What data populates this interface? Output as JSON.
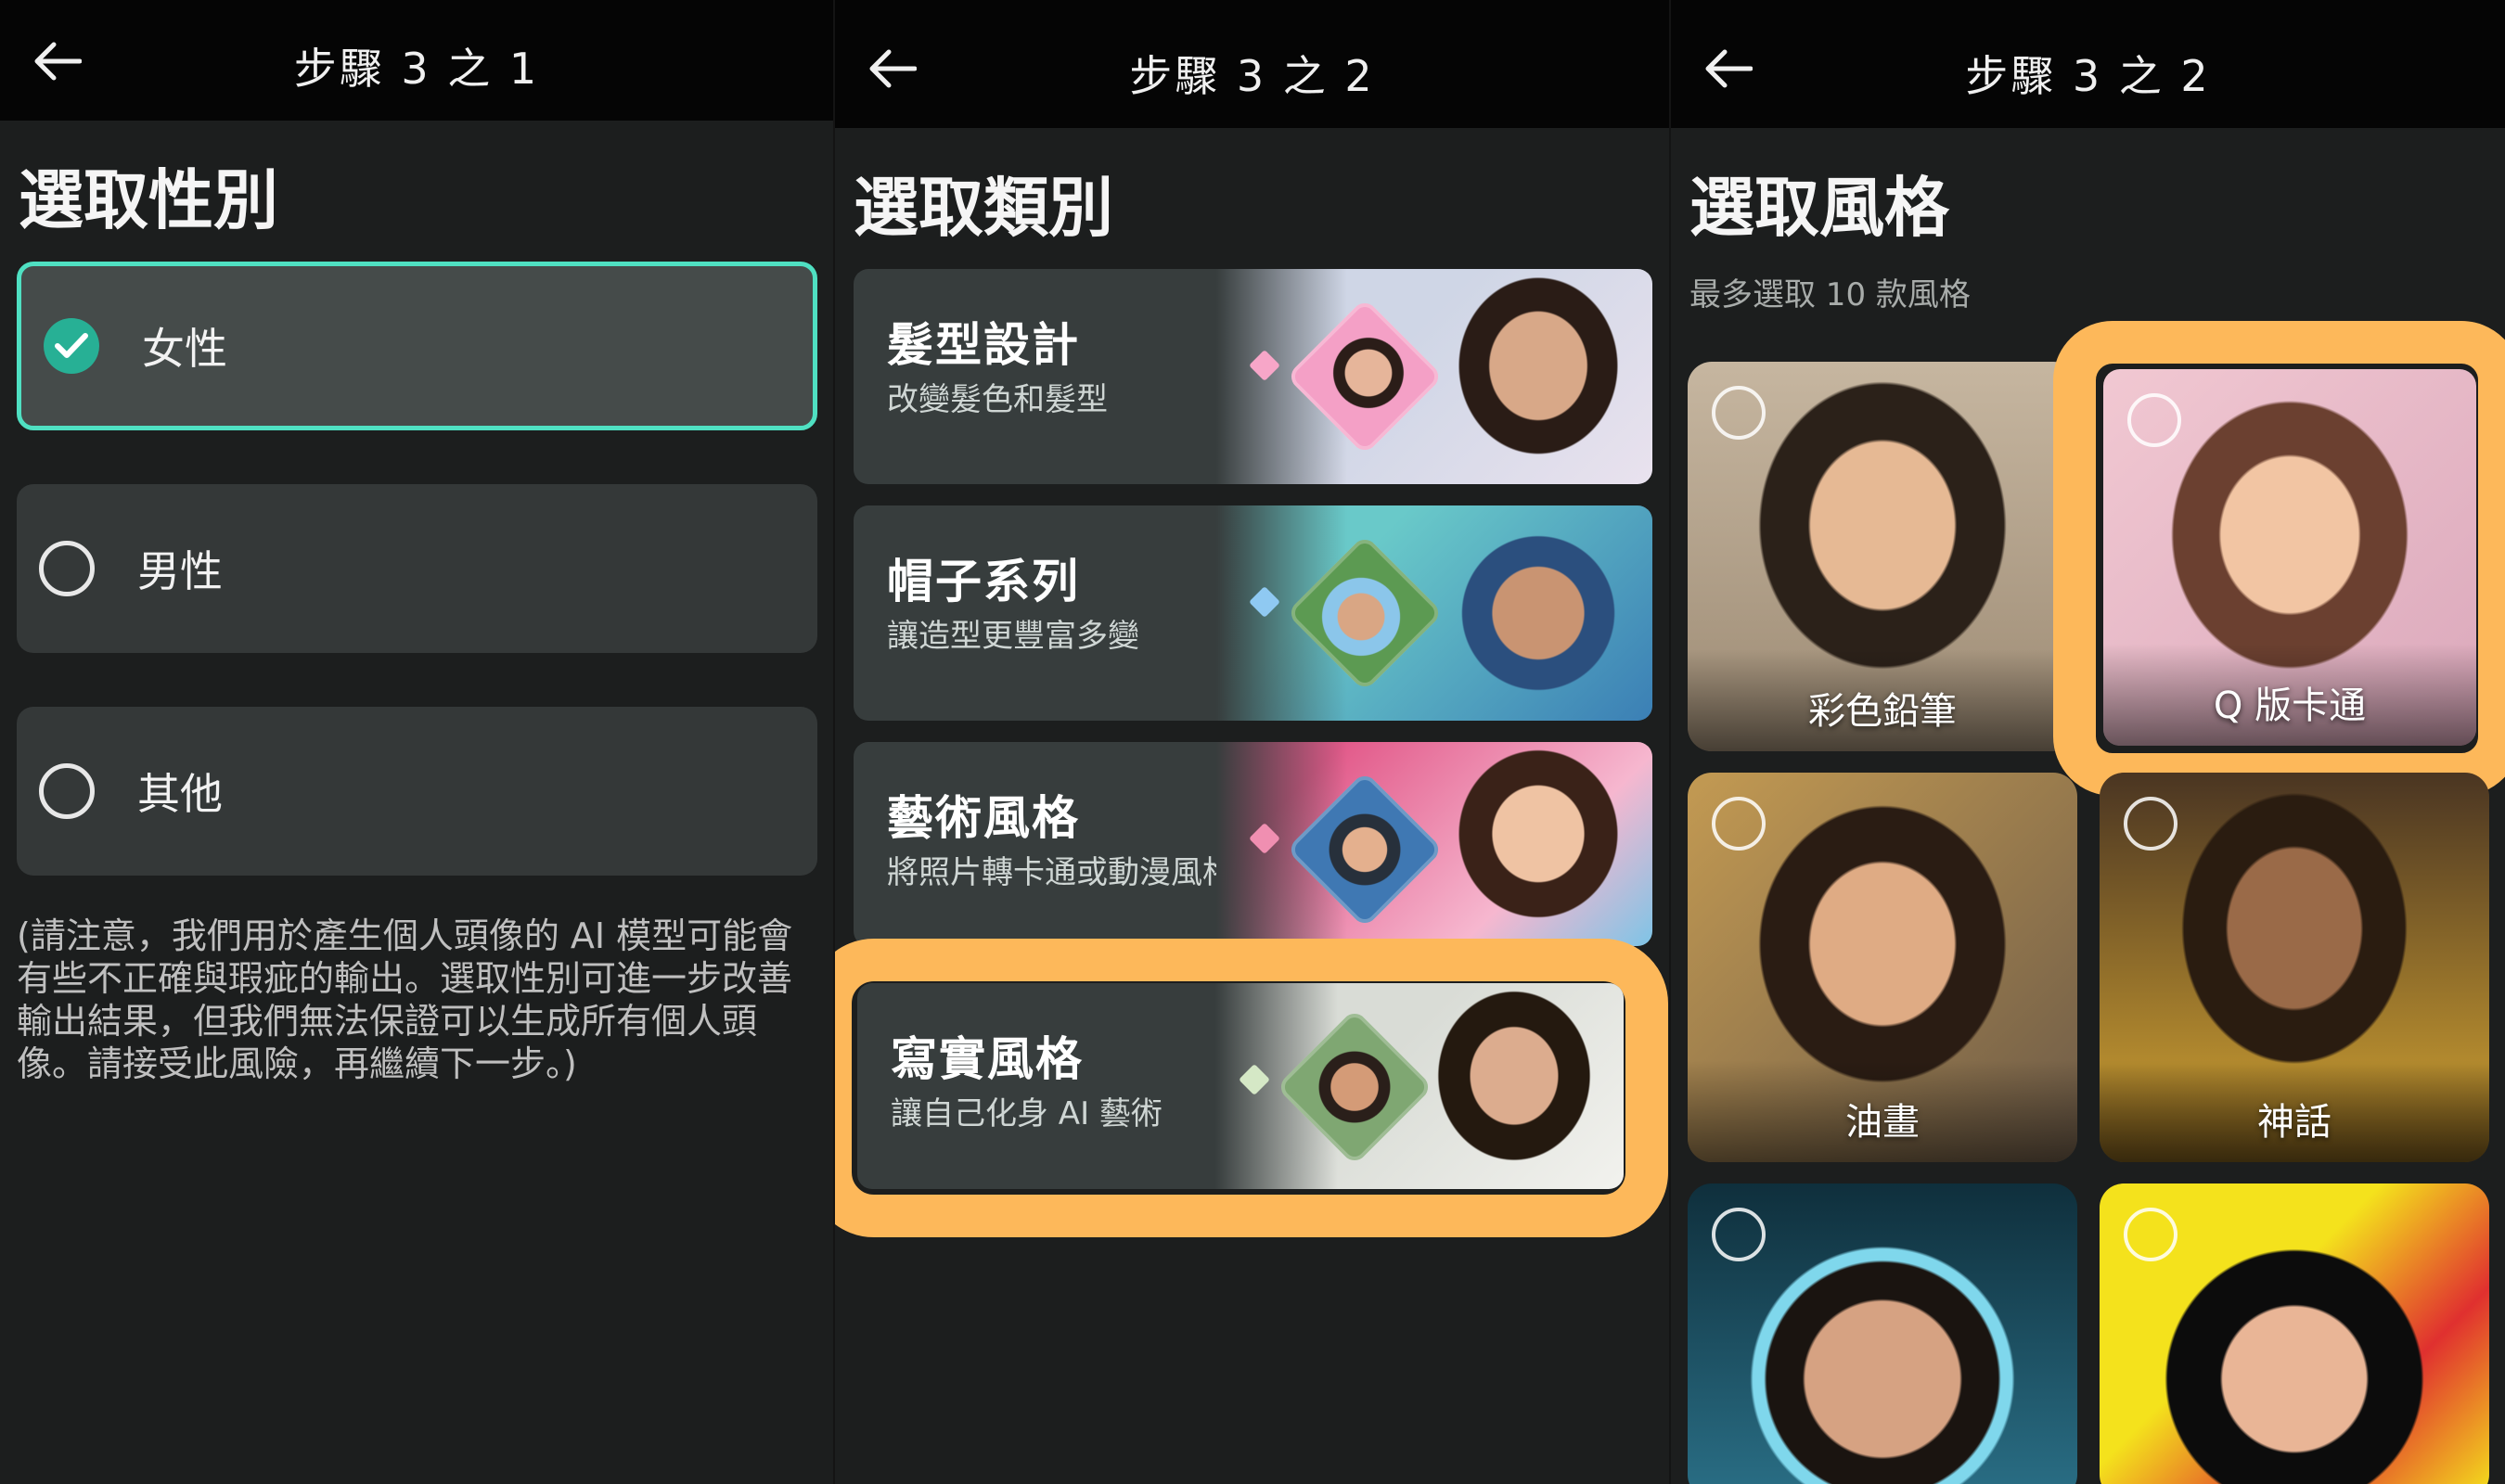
{
  "panel1": {
    "header": {
      "title": "步驟 3 之 1"
    },
    "title": "選取性別",
    "options": [
      {
        "label": "女性",
        "selected": true
      },
      {
        "label": "男性",
        "selected": false
      },
      {
        "label": "其他",
        "selected": false
      }
    ],
    "disclaimer": "(請注意，我們用於產生個人頭像的 AI 模型可能會有些不正確與瑕疵的輸出。選取性別可進一步改善輸出結果，但我們無法保證可以生成所有個人頭像。請接受此風險，再繼續下一步。)"
  },
  "panel2": {
    "header": {
      "title": "步驟 3 之 2"
    },
    "title": "選取類別",
    "categories": [
      {
        "name": "髮型設計",
        "desc": "改變髮色和髮型",
        "accent": "#f28ab8",
        "dot": "#f7a6c8"
      },
      {
        "name": "帽子系列",
        "desc": "讓造型更豐富多變",
        "accent": "#6fb3e6",
        "dot": "#8fc9f2"
      },
      {
        "name": "藝術風格",
        "desc": "將照片轉卡通或動漫風格",
        "accent": "#e86a9a",
        "dot": "#f08fb1"
      },
      {
        "name": "寫實風格",
        "desc": "讓自己化身 AI 藝術",
        "accent": "#8cb88a",
        "dot": "#d5e8c6",
        "highlighted": true
      }
    ]
  },
  "panel3": {
    "header": {
      "title": "步驟 3 之 2"
    },
    "title": "選取風格",
    "subtitle": "最多選取 10 款風格",
    "styles": [
      {
        "label": "彩色鉛筆",
        "bg": "#b7a58d"
      },
      {
        "label": "Q 版卡通",
        "bg": "#e8bcc8",
        "highlighted": true
      },
      {
        "label": "油畫",
        "bg": "#8a7256"
      },
      {
        "label": "神話",
        "bg": "#6b4d22"
      },
      {
        "label": "",
        "bg": "#1c4f63"
      },
      {
        "label": "",
        "bg": "#e8e020"
      }
    ]
  },
  "colors": {
    "accent_teal": "#4fe0c2",
    "highlight_orange": "#fdb85a",
    "card_bg": "#373d3d"
  }
}
